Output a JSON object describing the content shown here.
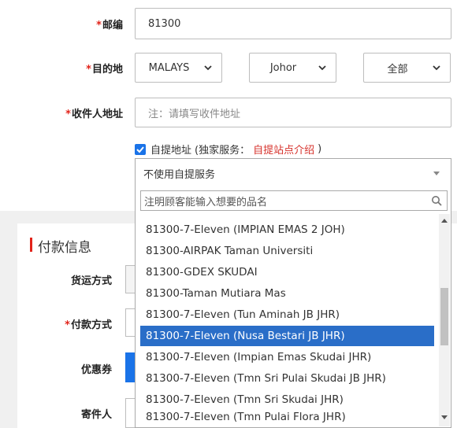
{
  "address": {
    "postcode": {
      "label": "邮编",
      "value": "81300"
    },
    "destination": {
      "label": "目的地",
      "country": "MALAYS",
      "state": "Johor",
      "city": "全部"
    },
    "recipient_address": {
      "label": "收件人地址",
      "placeholder": "注：请填写收件地址"
    },
    "required_mark": "*",
    "pickup": {
      "checkbox_label": "自提地址",
      "note_prefix": "(独家服务：",
      "link": "自提站点介绍",
      "note_suffix": ")"
    }
  },
  "payment": {
    "section_title": "付款信息",
    "shipping_method_label": "货运方式",
    "payment_method_label": "付款方式",
    "coupon_label": "优惠券",
    "sender_label": "寄件人"
  },
  "pickup_dropdown": {
    "selected": "不使用自提服务",
    "search_placeholder": "注明顾客能输入想要的品名",
    "options": [
      "81300-7-Eleven (IMPIAN EMAS 2 JOH)",
      "81300-AIRPAK Taman Universiti",
      "81300-GDEX SKUDAI",
      "81300-Taman Mutiara Mas",
      "81300-7-Eleven (Tun Aminah JB JHR)",
      "81300-7-Eleven (Nusa Bestari JB JHR)",
      "81300-7-Eleven (Impian Emas Skudai JHR)",
      "81300-7-Eleven (Tmn Sri Pulai Skudai JB JHR)",
      "81300-7-Eleven (Tmn Sri Skudai JHR)",
      "81300-7-Eleven (Tmn Pulai Flora JHR)"
    ],
    "highlighted_option": "81300-7-Eleven (Nusa Bestari JB JHR)"
  },
  "colors": {
    "required": "#e2231a",
    "link": "#d6302a",
    "highlight": "#2a6ec8",
    "checkbox": "#1a73e8"
  }
}
